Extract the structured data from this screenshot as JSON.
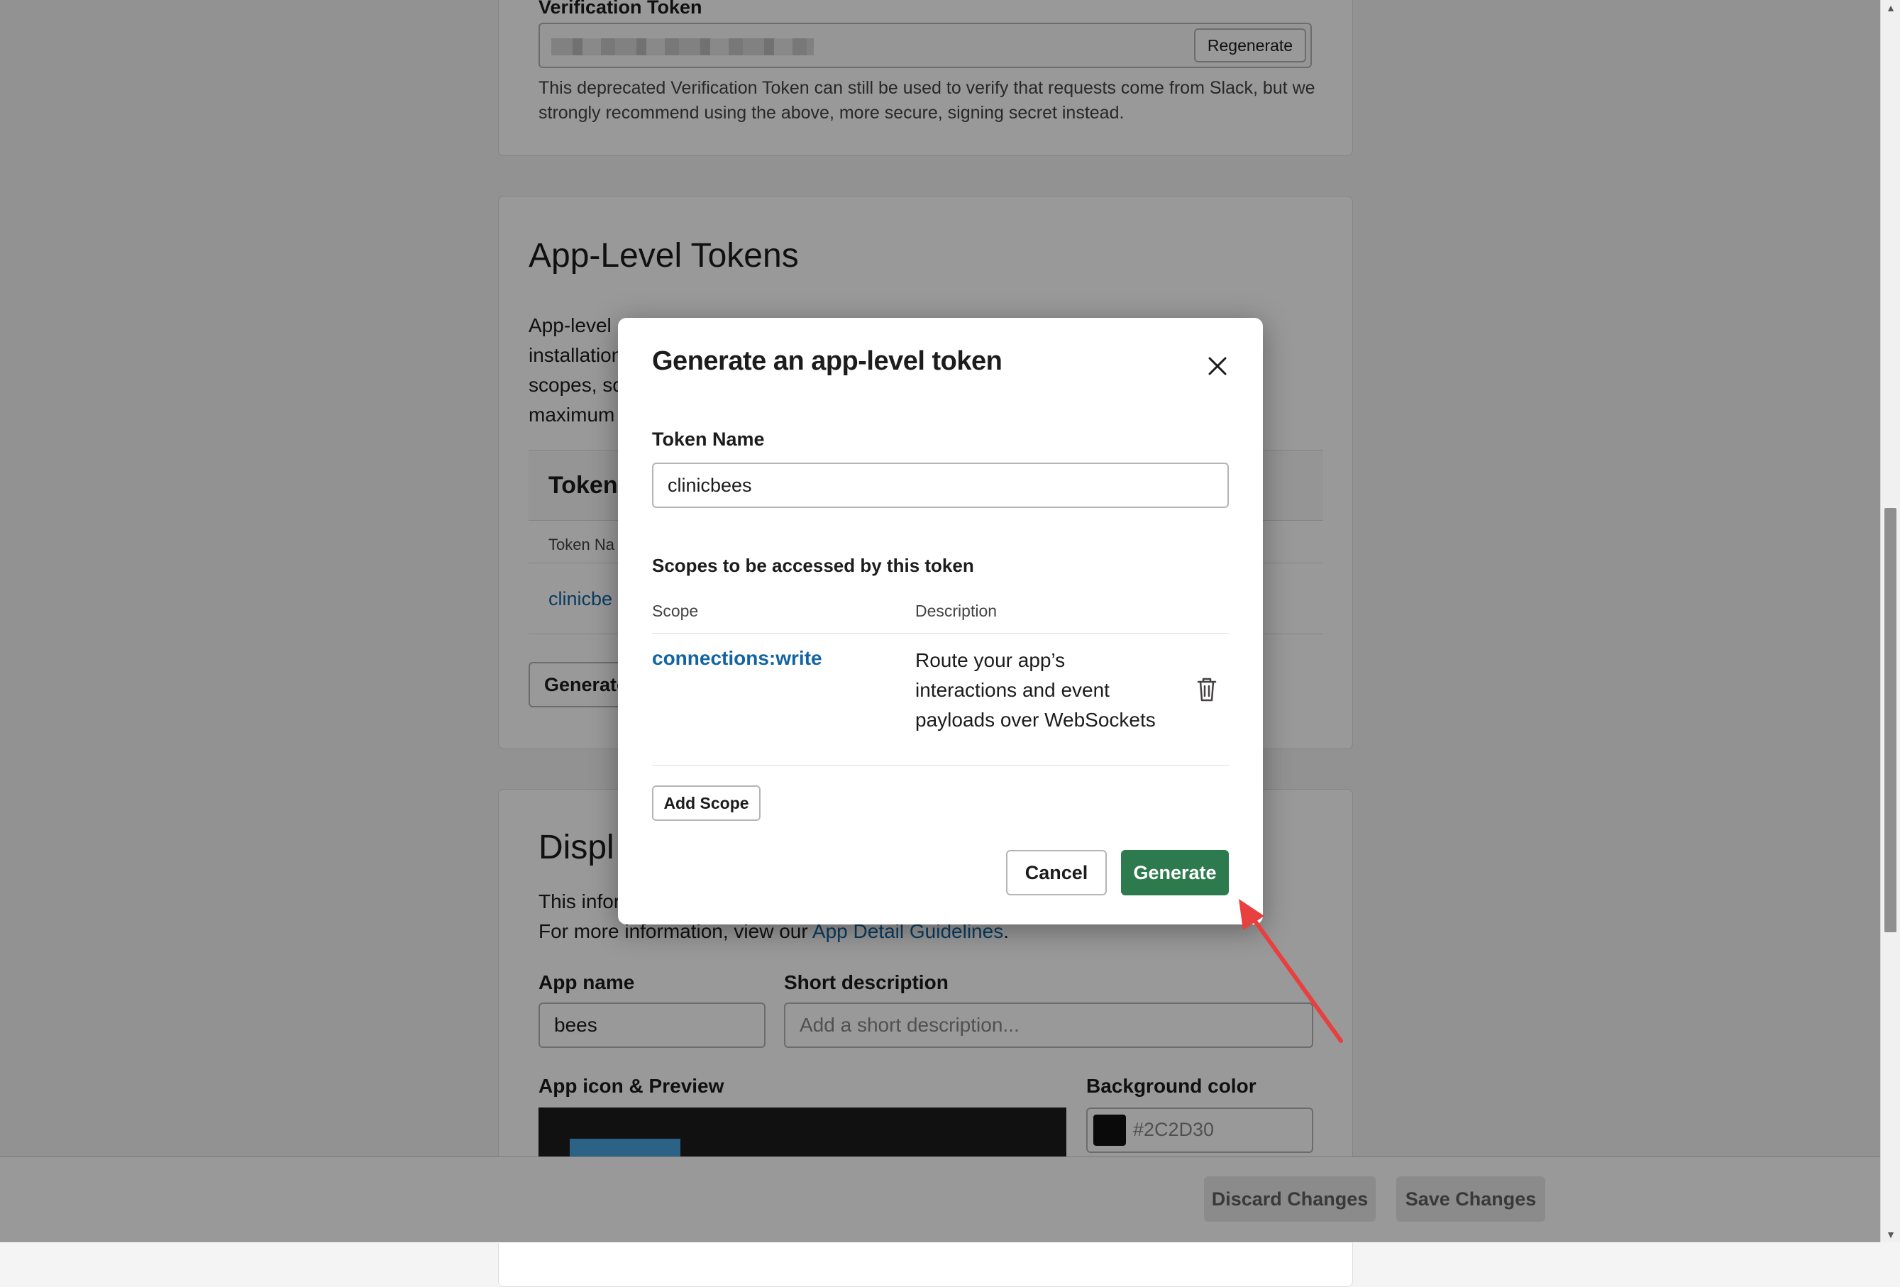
{
  "verification": {
    "label": "Verification Token",
    "regenerate_label": "Regenerate",
    "description": "This deprecated Verification Token can still be used to verify that requests come from Slack, but we strongly recommend using the above, more secure, signing secret instead."
  },
  "app_level": {
    "title": "App-Level Tokens",
    "desc_fragments": [
      "App-level",
      "installation",
      "scopes, so",
      "maximum"
    ],
    "tokens_header": "Tokens",
    "column_fragment": "Token Na",
    "row_fragment": "clinicbe",
    "generate_fragment": "Generate"
  },
  "display": {
    "title_fragment": "Displ",
    "info_fragment": "This infor",
    "more_info_prefix": "For more information, view our ",
    "guidelines_link": "App Detail Guidelines",
    "more_info_suffix": ".",
    "app_name_label": "App name",
    "app_name_value": "bees",
    "short_desc_label": "Short description",
    "short_desc_placeholder": "Add a short description...",
    "icon_label": "App icon & Preview",
    "bg_color_label": "Background color",
    "bg_color_value": "#2C2D30"
  },
  "footer": {
    "discard_label": "Discard Changes",
    "save_label": "Save Changes"
  },
  "modal": {
    "title": "Generate an app-level token",
    "token_name_label": "Token Name",
    "token_name_value": "clinicbees",
    "scopes_label": "Scopes to be accessed by this token",
    "columns": [
      "Scope",
      "Description"
    ],
    "scopes": [
      {
        "name": "connections:write",
        "description": "Route your app’s interactions and event payloads over WebSockets"
      }
    ],
    "add_scope_label": "Add Scope",
    "cancel_label": "Cancel",
    "generate_label": "Generate"
  },
  "colors": {
    "primary_green": "#2e7a4f",
    "link_blue": "#1264a3",
    "annotation_red": "#e8403f",
    "swatch": "#2C2D30"
  },
  "icons": [
    "close-icon",
    "trash-icon",
    "annotation-arrow-icon"
  ]
}
